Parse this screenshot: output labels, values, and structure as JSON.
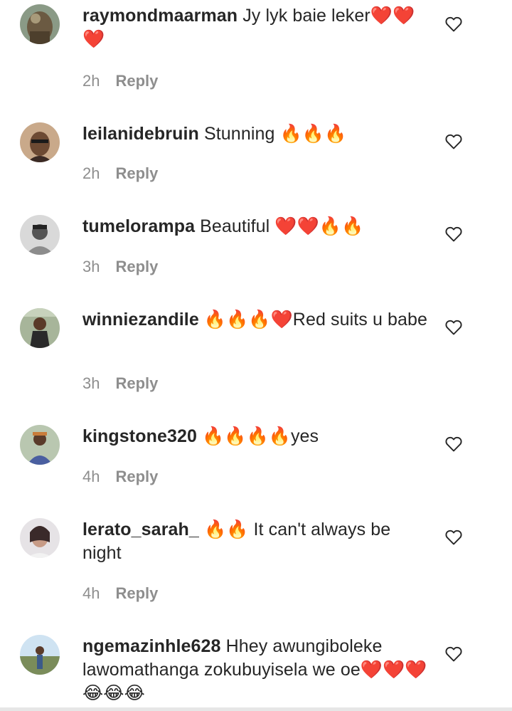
{
  "comments": [
    {
      "username": "raymondmaarman",
      "text": "Jy lyk baie leker❤️❤️❤️",
      "time": "2h",
      "reply": "Reply",
      "avatar": "avatar-raymond"
    },
    {
      "username": "leilanidebruin",
      "text": "Stunning 🔥🔥🔥",
      "time": "2h",
      "reply": "Reply",
      "avatar": "avatar-leilani"
    },
    {
      "username": "tumelorampa",
      "text": "Beautiful ❤️❤️🔥🔥",
      "time": "3h",
      "reply": "Reply",
      "avatar": "avatar-tumelo"
    },
    {
      "username": "winniezandile",
      "text": "🔥🔥🔥❤️Red suits u babe",
      "time": "3h",
      "reply": "Reply",
      "avatar": "avatar-winnie"
    },
    {
      "username": "kingstone320",
      "text": "🔥🔥🔥🔥yes",
      "time": "4h",
      "reply": "Reply",
      "avatar": "avatar-kingstone"
    },
    {
      "username": "lerato_sarah_",
      "text": "🔥🔥 It can't always be night",
      "time": "4h",
      "reply": "Reply",
      "avatar": "avatar-lerato"
    },
    {
      "username": "ngemazinhle628",
      "text": "Hhey awungiboleke lawomathanga zokubuyisela we oe❤️❤️❤️😂😂😂",
      "time": "",
      "reply": "",
      "avatar": "avatar-ngema"
    }
  ],
  "icons": {
    "like": "heart-outline-icon"
  },
  "colors": {
    "text": "#262626",
    "meta": "#8e8e8e"
  }
}
